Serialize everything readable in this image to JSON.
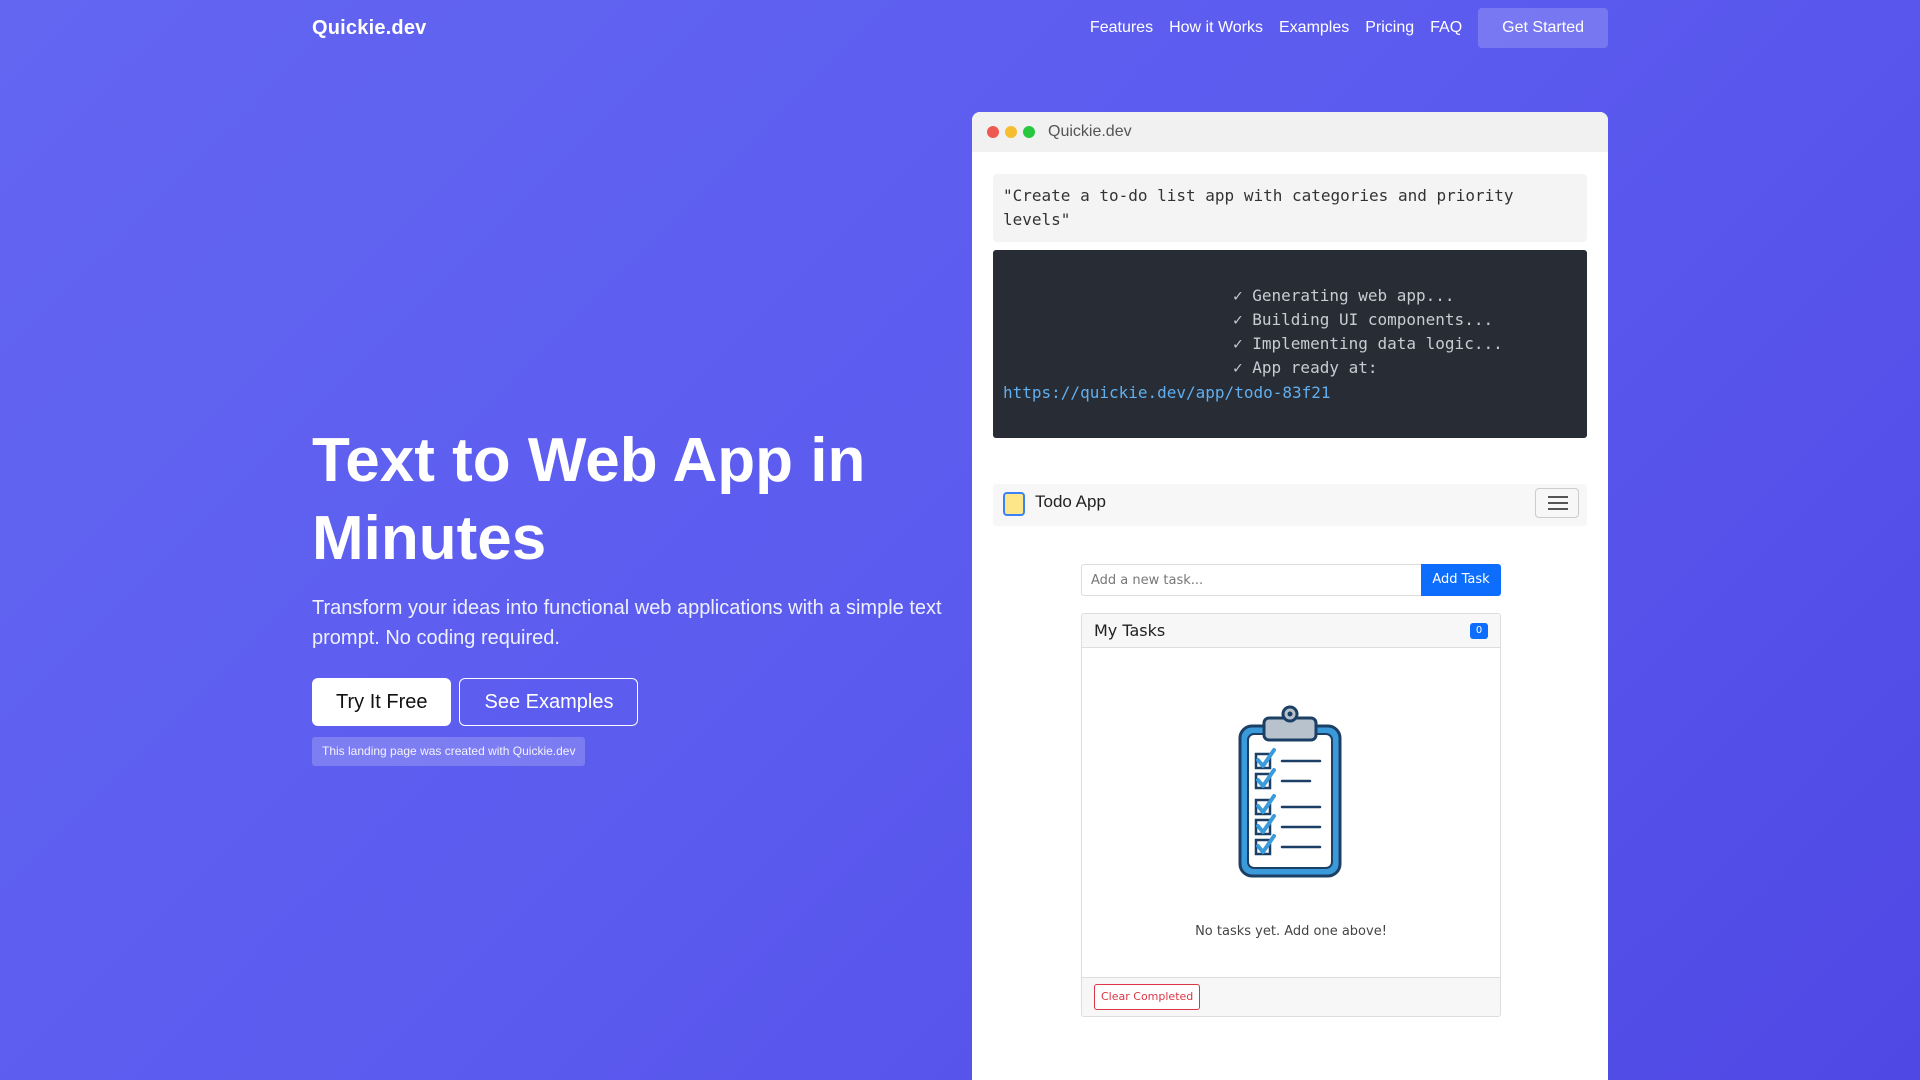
{
  "nav": {
    "brand": "Quickie.dev",
    "links": [
      "Features",
      "How it Works",
      "Examples",
      "Pricing",
      "FAQ"
    ],
    "cta": "Get Started"
  },
  "hero": {
    "title": "Text to Web App in Minutes",
    "subtitle": "Transform your ideas into functional web applications with a simple text prompt. No coding required.",
    "primary_button": "Try It Free",
    "secondary_button": "See Examples",
    "credit_badge": "This landing page was created with Quickie.dev"
  },
  "demo": {
    "window_title": "Quickie.dev",
    "window_dot_colors": [
      "#ee5a52",
      "#f5bd2f",
      "#27c840"
    ],
    "prompt": "\"Create a to-do list app with categories and priority levels\"",
    "terminal": {
      "lines": [
        "✓ Generating web app...",
        "✓ Building UI components...",
        "✓ Implementing data logic...",
        "✓ App ready at:"
      ],
      "url": "https://quickie.dev/app/todo-83f21"
    },
    "app": {
      "logo_icon": "notepad-icon",
      "title": "Todo App",
      "menu_icon": "hamburger-menu-icon",
      "input_placeholder": "Add a new task...",
      "add_button": "Add Task",
      "card_title": "My Tasks",
      "task_count": "0",
      "empty_icon": "clipboard-checklist-icon",
      "empty_message": "No tasks yet. Add one above!",
      "clear_button": "Clear Completed"
    }
  },
  "colors": {
    "accent_blue": "#0d6efd",
    "danger_red": "#dc3545",
    "terminal_bg": "#282c34",
    "terminal_link": "#61afef"
  }
}
